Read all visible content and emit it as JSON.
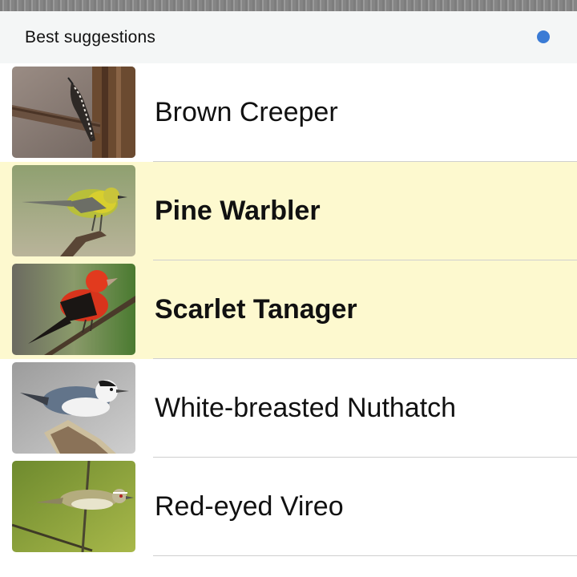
{
  "header": {
    "title": "Best suggestions",
    "status_dot_color": "#3a7bd5"
  },
  "suggestions": [
    {
      "name": "Brown Creeper",
      "highlighted": false,
      "image_icon": "brown-creeper-photo"
    },
    {
      "name": "Pine Warbler",
      "highlighted": true,
      "image_icon": "pine-warbler-photo"
    },
    {
      "name": "Scarlet Tanager",
      "highlighted": true,
      "image_icon": "scarlet-tanager-photo"
    },
    {
      "name": "White-breasted Nuthatch",
      "highlighted": false,
      "image_icon": "white-breasted-nuthatch-photo"
    },
    {
      "name": "Red-eyed Vireo",
      "highlighted": false,
      "image_icon": "red-eyed-vireo-photo"
    }
  ],
  "colors": {
    "highlight_background": "#fdf9cf",
    "header_background": "#f4f6f6"
  }
}
